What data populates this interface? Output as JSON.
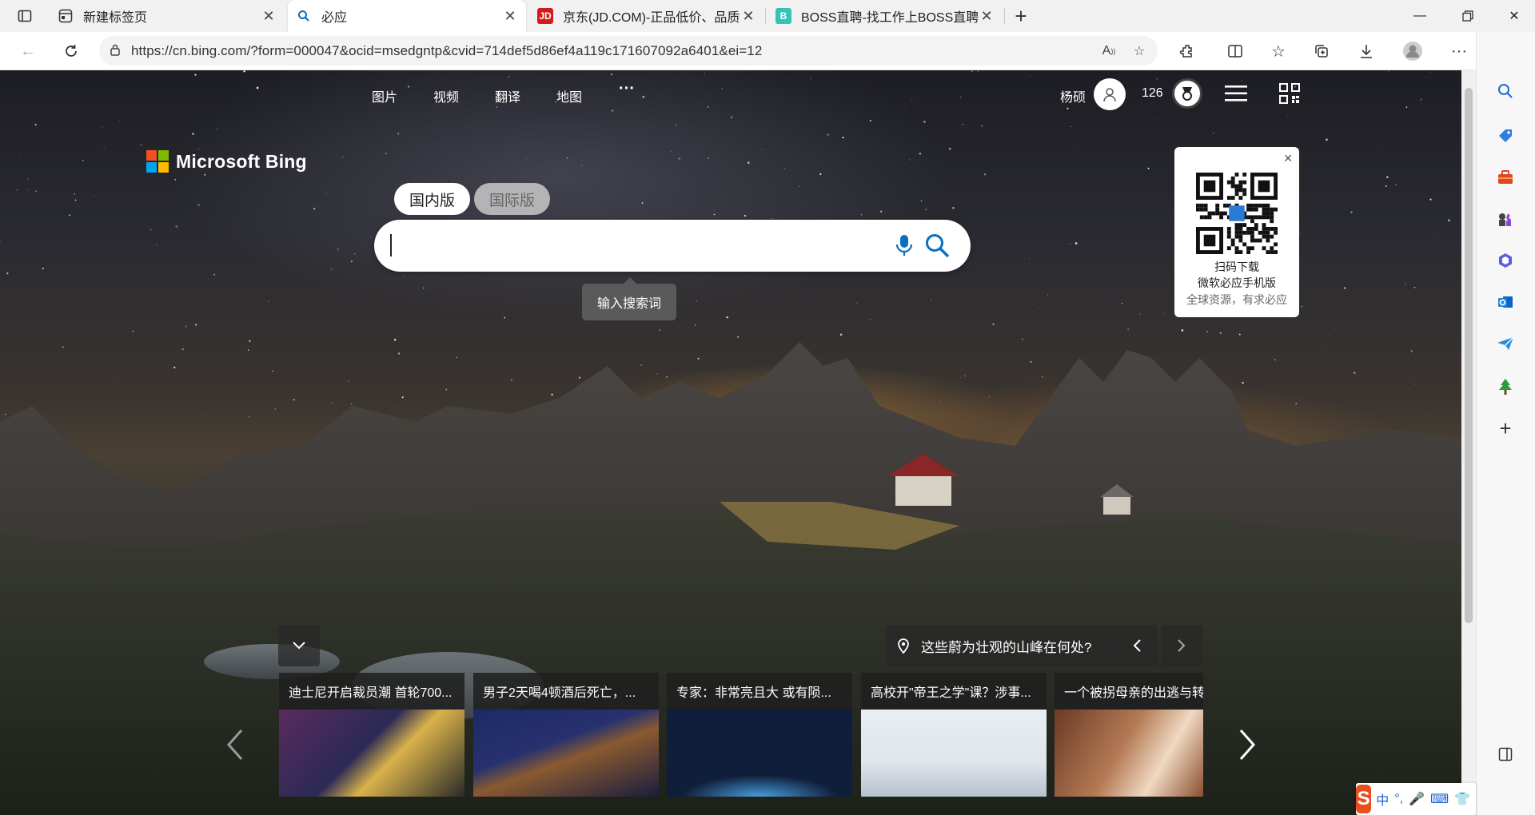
{
  "tabs": [
    {
      "title": "新建标签页",
      "favicon": "new-tab-icon"
    },
    {
      "title": "必应",
      "favicon": "bing-search-icon"
    },
    {
      "title": "京东(JD.COM)-正品低价、品质保障",
      "favicon": "jd-icon",
      "favicon_text": "JD"
    },
    {
      "title": "BOSS直聘-找工作上BOSS直聘直接谈",
      "favicon": "boss-icon",
      "favicon_text": "B"
    }
  ],
  "address": {
    "url": "https://cn.bing.com/?form=000047&ocid=msedgntp&cvid=714def5d86ef4a119c171607092a6401&ei=12"
  },
  "bing": {
    "logo_text": "Microsoft Bing",
    "nav": [
      "图片",
      "视频",
      "翻译",
      "地图"
    ],
    "more": "···",
    "user_name": "杨硕",
    "points": "126",
    "region_cn": "国内版",
    "region_intl": "国际版",
    "search_tooltip": "输入搜索词"
  },
  "qr_card": {
    "line1": "扫码下载",
    "line2": "微软必应手机版",
    "line3": "全球资源，有求必应"
  },
  "location_question": "这些蔚为壮观的山峰在何处?",
  "news": [
    {
      "caption": "迪士尼开启裁员潮 首轮700...",
      "image": "mickey-mouse"
    },
    {
      "caption": "男子2天喝4顿酒后死亡，...",
      "image": "gavel"
    },
    {
      "caption": "专家：非常亮且大 或有陨...",
      "image": "meteor-earth"
    },
    {
      "caption": "高校开\"帝王之学\"课？涉事...",
      "image": "classroom"
    },
    {
      "caption": "一个被拐母亲的出逃与转",
      "image": "gavel-hand"
    }
  ],
  "ime": {
    "mode": "中",
    "punct": "°,"
  },
  "colors": {
    "accent": "#0a6fbf",
    "ms_red": "#f25022",
    "ms_green": "#7fba00",
    "ms_blue": "#00a4ef",
    "ms_yellow": "#ffb900"
  }
}
